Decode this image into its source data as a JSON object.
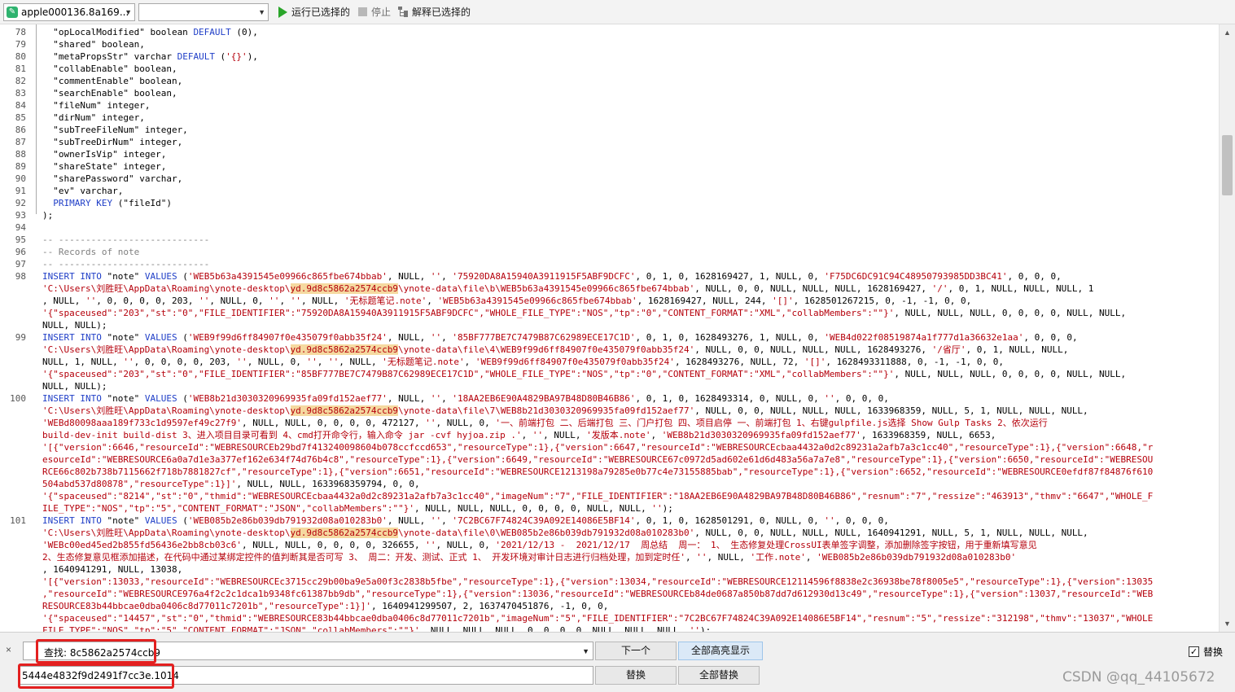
{
  "toolbar": {
    "database_select": "apple000136.8a169...",
    "schema_select": "",
    "run_selected": "运行已选择的",
    "stop": "停止",
    "explain_selected": "解释已选择的"
  },
  "editor": {
    "line_numbers": [
      "78",
      "79",
      "80",
      "81",
      "82",
      "83",
      "84",
      "85",
      "86",
      "87",
      "88",
      "89",
      "90",
      "91",
      "92",
      "93",
      "94",
      "95",
      "96",
      "97",
      "98",
      "",
      "",
      "",
      "",
      "99",
      "",
      "",
      "",
      "",
      "100",
      "",
      "",
      "",
      "",
      "",
      "",
      "",
      "",
      "",
      "101",
      "",
      "",
      "",
      "",
      "",
      "",
      "",
      "",
      "",
      ""
    ],
    "lines": [
      [
        [
          "",
          "  \"opLocalModified\" boolean "
        ],
        [
          "kw",
          "DEFAULT"
        ],
        [
          "",
          " (0),"
        ]
      ],
      [
        [
          "",
          "  \"shared\" boolean,"
        ]
      ],
      [
        [
          "",
          "  \"metaPropsStr\" varchar "
        ],
        [
          "kw",
          "DEFAULT"
        ],
        [
          "",
          " ("
        ],
        [
          "str",
          "'{}'"
        ],
        [
          "",
          "),"
        ]
      ],
      [
        [
          "",
          "  \"collabEnable\" boolean,"
        ]
      ],
      [
        [
          "",
          "  \"commentEnable\" boolean,"
        ]
      ],
      [
        [
          "",
          "  \"searchEnable\" boolean,"
        ]
      ],
      [
        [
          "",
          "  \"fileNum\" integer,"
        ]
      ],
      [
        [
          "",
          "  \"dirNum\" integer,"
        ]
      ],
      [
        [
          "",
          "  \"subTreeFileNum\" integer,"
        ]
      ],
      [
        [
          "",
          "  \"subTreeDirNum\" integer,"
        ]
      ],
      [
        [
          "",
          "  \"ownerIsVip\" integer,"
        ]
      ],
      [
        [
          "",
          "  \"shareState\" integer,"
        ]
      ],
      [
        [
          "",
          "  \"sharePassword\" varchar,"
        ]
      ],
      [
        [
          "",
          "  \"ev\" varchar,"
        ]
      ],
      [
        [
          "kw",
          "  PRIMARY KEY"
        ],
        [
          "",
          " (\"fileId\")"
        ]
      ],
      [
        [
          "",
          ");"
        ]
      ],
      [
        [
          "",
          ""
        ]
      ],
      [
        [
          "cm",
          "-- ----------------------------"
        ]
      ],
      [
        [
          "cm",
          "-- Records of note"
        ]
      ],
      [
        [
          "cm",
          "-- ----------------------------"
        ]
      ],
      [
        [
          "kw",
          "INSERT INTO"
        ],
        [
          "",
          " \"note\" "
        ],
        [
          "kw",
          "VALUES"
        ],
        [
          "",
          " ("
        ],
        [
          "str",
          "'WEB5b63a4391545e09966c865fbe674bbab'"
        ],
        [
          "",
          ", NULL, "
        ],
        [
          "str",
          "''"
        ],
        [
          "",
          ", "
        ],
        [
          "str",
          "'75920DA8A15940A3911915F5ABF9DCFC'"
        ],
        [
          "",
          ", 0, 1, 0, 1628169427, 1, NULL, 0, "
        ],
        [
          "str",
          "'F75DC6DC91C94C48950793985DD3BC41'"
        ],
        [
          "",
          ", 0, 0, 0,"
        ]
      ],
      [
        [
          "str",
          "'C:\\Users\\刘胜旺\\AppData\\Roaming\\ynote-desktop\\"
        ],
        [
          "hl",
          "yd.9d8c5862a2574ccb9"
        ],
        [
          "str",
          "\\ynote-data\\file\\b\\WEB5b63a4391545e09966c865fbe674bbab'"
        ],
        [
          "",
          ", NULL, 0, 0, NULL, NULL, NULL, 1628169427, "
        ],
        [
          "str",
          "'/'"
        ],
        [
          "",
          ", 0, 1, NULL, NULL, NULL, 1"
        ]
      ],
      [
        [
          "",
          ", NULL, "
        ],
        [
          "str",
          "''"
        ],
        [
          "",
          ", 0, 0, 0, 0, 203, "
        ],
        [
          "str",
          "''"
        ],
        [
          "",
          ", NULL, 0, "
        ],
        [
          "str",
          "''"
        ],
        [
          "",
          ", "
        ],
        [
          "str",
          "''"
        ],
        [
          "",
          ", NULL, "
        ],
        [
          "str",
          "'无标题笔记.note'"
        ],
        [
          "",
          ", "
        ],
        [
          "str",
          "'WEB5b63a4391545e09966c865fbe674bbab'"
        ],
        [
          "",
          ", 1628169427, NULL, 244, "
        ],
        [
          "str",
          "'[]'"
        ],
        [
          "",
          ", 1628501267215, 0, -1, -1, 0, 0,"
        ]
      ],
      [
        [
          "str",
          "'{\"spaceused\":\"203\",\"st\":\"0\",\"FILE_IDENTIFIER\":\"75920DA8A15940A3911915F5ABF9DCFC\",\"WHOLE_FILE_TYPE\":\"NOS\",\"tp\":\"0\",\"CONTENT_FORMAT\":\"XML\",\"collabMembers\":\"\"}'"
        ],
        [
          "",
          ", NULL, NULL, NULL, 0, 0, 0, 0, NULL, NULL,"
        ]
      ],
      [
        [
          "",
          "NULL, NULL);"
        ]
      ],
      [
        [
          "kw",
          "INSERT INTO"
        ],
        [
          "",
          " \"note\" "
        ],
        [
          "kw",
          "VALUES"
        ],
        [
          "",
          " ("
        ],
        [
          "str",
          "'WEB9f99d6ff84907f0e435079f0abb35f24'"
        ],
        [
          "",
          ", NULL, "
        ],
        [
          "str",
          "''"
        ],
        [
          "",
          ", "
        ],
        [
          "str",
          "'85BF777BE7C7479B87C62989ECE17C1D'"
        ],
        [
          "",
          ", 0, 1, 0, 1628493276, 1, NULL, 0, "
        ],
        [
          "str",
          "'WEB4d022f08519874a1f777d1a36632e1aa'"
        ],
        [
          "",
          ", 0, 0, 0,"
        ]
      ],
      [
        [
          "str",
          "'C:\\Users\\刘胜旺\\AppData\\Roaming\\ynote-desktop\\"
        ],
        [
          "hl",
          "yd.9d8c5862a2574ccb9"
        ],
        [
          "str",
          "\\ynote-data\\file\\4\\WEB9f99d6ff84907f0e435079f0abb35f24'"
        ],
        [
          "",
          ", NULL, 0, 0, NULL, NULL, NULL, 1628493276, "
        ],
        [
          "str",
          "'/省厅'"
        ],
        [
          "",
          ", 0, 1, NULL, NULL,"
        ]
      ],
      [
        [
          "",
          "NULL, 1, NULL, "
        ],
        [
          "str",
          "''"
        ],
        [
          "",
          ", 0, 0, 0, 0, 203, "
        ],
        [
          "str",
          "''"
        ],
        [
          "",
          ", NULL, 0, "
        ],
        [
          "str",
          "''"
        ],
        [
          "",
          ", "
        ],
        [
          "str",
          "''"
        ],
        [
          "",
          ", NULL, "
        ],
        [
          "str",
          "'无标题笔记.note'"
        ],
        [
          "",
          ", "
        ],
        [
          "str",
          "'WEB9f99d6ff84907f0e435079f0abb35f24'"
        ],
        [
          "",
          ", 1628493276, NULL, 72, "
        ],
        [
          "str",
          "'[]'"
        ],
        [
          "",
          ", 1628493311888, 0, -1, -1, 0, 0,"
        ]
      ],
      [
        [
          "str",
          "'{\"spaceused\":\"203\",\"st\":\"0\",\"FILE_IDENTIFIER\":\"85BF777BE7C7479B87C62989ECE17C1D\",\"WHOLE_FILE_TYPE\":\"NOS\",\"tp\":\"0\",\"CONTENT_FORMAT\":\"XML\",\"collabMembers\":\"\"}'"
        ],
        [
          "",
          ", NULL, NULL, NULL, 0, 0, 0, 0, NULL, NULL,"
        ]
      ],
      [
        [
          "",
          "NULL, NULL);"
        ]
      ],
      [
        [
          "kw",
          "INSERT INTO"
        ],
        [
          "",
          " \"note\" "
        ],
        [
          "kw",
          "VALUES"
        ],
        [
          "",
          " ("
        ],
        [
          "str",
          "'WEB8b21d3030320969935fa09fd152aef77'"
        ],
        [
          "",
          ", NULL, "
        ],
        [
          "str",
          "''"
        ],
        [
          "",
          ", "
        ],
        [
          "str",
          "'18AA2EB6E90A4829BA97B48D80B46B86'"
        ],
        [
          "",
          ", 0, 1, 0, 1628493314, 0, NULL, 0, "
        ],
        [
          "str",
          "''"
        ],
        [
          "",
          ", 0, 0, 0,"
        ]
      ],
      [
        [
          "str",
          "'C:\\Users\\刘胜旺\\AppData\\Roaming\\ynote-desktop\\"
        ],
        [
          "hl",
          "yd.9d8c5862a2574ccb9"
        ],
        [
          "str",
          "\\ynote-data\\file\\7\\WEB8b21d3030320969935fa09fd152aef77'"
        ],
        [
          "",
          ", NULL, 0, 0, NULL, NULL, NULL, 1633968359, NULL, 5, 1, NULL, NULL, NULL,"
        ]
      ],
      [
        [
          "str",
          "'WEBd80098aaa189f733c1d9597ef49c27f9'"
        ],
        [
          "",
          ", NULL, NULL, 0, 0, 0, 0, 472127, "
        ],
        [
          "str",
          "''"
        ],
        [
          "",
          ", NULL, 0, "
        ],
        [
          "str",
          "'一、前端打包 二、后端打包 三、门户打包 四、项目启停 一、前端打包 1、右键gulpfile.js选择 Show Gulp Tasks 2、依次运行"
        ]
      ],
      [
        [
          "str",
          "build-dev-init build-dist 3、进入项目目录可看到 4、cmd打开命令行，输入命令 jar -cvf hyjoa.zip .'"
        ],
        [
          "",
          ", "
        ],
        [
          "str",
          "''"
        ],
        [
          "",
          ", NULL, "
        ],
        [
          "str",
          "'发版本.note'"
        ],
        [
          "",
          ", "
        ],
        [
          "str",
          "'WEB8b21d3030320969935fa09fd152aef77'"
        ],
        [
          "",
          ", 1633968359, NULL, 6653,"
        ]
      ],
      [
        [
          "str",
          "'[{\"version\":6646,\"resourceId\":\"WEBRESOURCEb29bd7f413240098604b078ccfccd653\",\"resourceType\":1},{\"version\":6647,\"resourceId\":\"WEBRESOURCEcbaa4432a0d2c89231a2afb7a3c1cc40\",\"resourceType\":1},{\"version\":6648,\"r"
        ]
      ],
      [
        [
          "str",
          "esourceId\":\"WEBRESOURCE6a0a7d1e3a377ef162e634f74d76b4c8\",\"resourceType\":1},{\"version\":6649,\"resourceId\":\"WEBRESOURCE67c0972d5ad602e61d6d483a56a7a7e8\",\"resourceType\":1},{\"version\":6650,\"resourceId\":\"WEBRESOU"
        ]
      ],
      [
        [
          "str",
          "RCE66c802b738b7115662f718b7881827cf\",\"resourceType\":1},{\"version\":6651,\"resourceId\":\"WEBRESOURCE1213198a79285e0b77c4e73155885bab\",\"resourceType\":1},{\"version\":6652,\"resourceId\":\"WEBRESOURCE0efdf87f84876f610"
        ]
      ],
      [
        [
          "str",
          "504abd537d80878\",\"resourceType\":1}]'"
        ],
        [
          "",
          ", NULL, NULL, 1633968359794, 0, 0,"
        ]
      ],
      [
        [
          "str",
          "'{\"spaceused\":\"8214\",\"st\":\"0\",\"thmid\":\"WEBRESOURCEcbaa4432a0d2c89231a2afb7a3c1cc40\",\"imageNum\":\"7\",\"FILE_IDENTIFIER\":\"18AA2EB6E90A4829BA97B48D80B46B86\",\"resnum\":\"7\",\"ressize\":\"463913\",\"thmv\":\"6647\",\"WHOLE_F"
        ]
      ],
      [
        [
          "str",
          "ILE_TYPE\":\"NOS\",\"tp\":\"5\",\"CONTENT_FORMAT\":\"JSON\",\"collabMembers\":\"\"}'"
        ],
        [
          "",
          ", NULL, NULL, NULL, 0, 0, 0, 0, NULL, NULL, "
        ],
        [
          "str",
          "''"
        ],
        [
          "",
          ");"
        ]
      ],
      [
        [
          "kw",
          "INSERT INTO"
        ],
        [
          "",
          " \"note\" "
        ],
        [
          "kw",
          "VALUES"
        ],
        [
          "",
          " ("
        ],
        [
          "str",
          "'WEB085b2e86b039db791932d08a010283b0'"
        ],
        [
          "",
          ", NULL, "
        ],
        [
          "str",
          "''"
        ],
        [
          "",
          ", "
        ],
        [
          "str",
          "'7C2BC67F74824C39A092E14086E5BF14'"
        ],
        [
          "",
          ", 0, 1, 0, 1628501291, 0, NULL, 0, "
        ],
        [
          "str",
          "''"
        ],
        [
          "",
          ", 0, 0, 0,"
        ]
      ],
      [
        [
          "str",
          "'C:\\Users\\刘胜旺\\AppData\\Roaming\\ynote-desktop\\"
        ],
        [
          "hl",
          "yd.9d8c5862a2574ccb9"
        ],
        [
          "str",
          "\\ynote-data\\file\\0\\WEB085b2e86b039db791932d08a010283b0'"
        ],
        [
          "",
          ", NULL, 0, 0, NULL, NULL, NULL, 1640941291, NULL, 5, 1, NULL, NULL, NULL,"
        ]
      ],
      [
        [
          "str",
          "'WEBc00ed45ed2b855fd56436e2bb8cb03c6'"
        ],
        [
          "",
          ", NULL, NULL, 0, 0, 0, 0, 326655, "
        ],
        [
          "str",
          "''"
        ],
        [
          "",
          ", NULL, 0, "
        ],
        [
          "str",
          "'2021/12/13 -  2021/12/17  周总结  周一： 1、 生态修复处理CrossUI表单签字调整，添加删除签字按钮，用于重新填写意见"
        ]
      ],
      [
        [
          "str",
          "2、生态修复意见框添加描述，在代码中通过某绑定控件的值判断其是否可写 3、 周二：开发、测试、正式 1、 开发环境对审计日志进行归档处理，加到定时任'"
        ],
        [
          "",
          ", "
        ],
        [
          "str",
          "''"
        ],
        [
          "",
          ", NULL, "
        ],
        [
          "str",
          "'工作.note'"
        ],
        [
          "",
          ", "
        ],
        [
          "str",
          "'WEB085b2e86b039db791932d08a010283b0'"
        ]
      ],
      [
        [
          "",
          ", 1640941291, NULL, 13038,"
        ]
      ],
      [
        [
          "str",
          "'[{\"version\":13033,\"resourceId\":\"WEBRESOURCEc3715cc29b00ba9e5a00f3c2838b5fbe\",\"resourceType\":1},{\"version\":13034,\"resourceId\":\"WEBRESOURCE12114596f8838e2c36938be78f8005e5\",\"resourceType\":1},{\"version\":13035"
        ]
      ],
      [
        [
          "str",
          ",\"resourceId\":\"WEBRESOURCE976a4f2c2c1dca1b9348fc61387bb9db\",\"resourceType\":1},{\"version\":13036,\"resourceId\":\"WEBRESOURCEb84de0687a850b87dd7d612930d13c49\",\"resourceType\":1},{\"version\":13037,\"resourceId\":\"WEB"
        ]
      ],
      [
        [
          "str",
          "RESOURCE83b44bbcae0dba0406c8d77011c7201b\",\"resourceType\":1}]'"
        ],
        [
          "",
          ", 1640941299507, 2, 1637470451876, -1, 0, 0,"
        ]
      ],
      [
        [
          "str",
          "'{\"spaceused\":\"14457\",\"st\":\"0\",\"thmid\":\"WEBRESOURCE83b44bbcae0dba0406c8d77011c7201b\",\"imageNum\":\"5\",\"FILE_IDENTIFIER\":\"7C2BC67F74824C39A092E14086E5BF14\",\"resnum\":\"5\",\"ressize\":\"312198\",\"thmv\":\"13037\",\"WHOLE"
        ]
      ],
      [
        [
          "str",
          "FILE_TYPE\":\"NOS\",\"tp\":\"5\",\"CONTENT_FORMAT\":\"JSON\",\"collabMembers\":\"\"}'"
        ],
        [
          "",
          ", NULL, NULL, NULL, 0, 0, 0, 0, NULL, NULL, NULL, "
        ],
        [
          "str",
          "''"
        ],
        [
          "",
          ");"
        ]
      ]
    ]
  },
  "scrollbar": {
    "up_arrow": "▲",
    "down_arrow": "▼"
  },
  "find_replace": {
    "close": "×",
    "find_value": "查找: 8c5862a2574ccb9",
    "replace_value": "5444e4832f9d2491f7cc3e.1014",
    "next_button": "下一个",
    "highlight_all_button": "全部高亮显示",
    "replace_button": "替换",
    "replace_all_button": "全部替换",
    "replace_checkbox_label": "替换",
    "replace_checked": true
  },
  "watermark": "CSDN @qq_44105672",
  "colors": {
    "keyword": "#1f3ec7",
    "string": "#b5000b",
    "comment": "#808080",
    "highlight_bg": "#f5d9a0",
    "annotation_red": "#e32020"
  }
}
